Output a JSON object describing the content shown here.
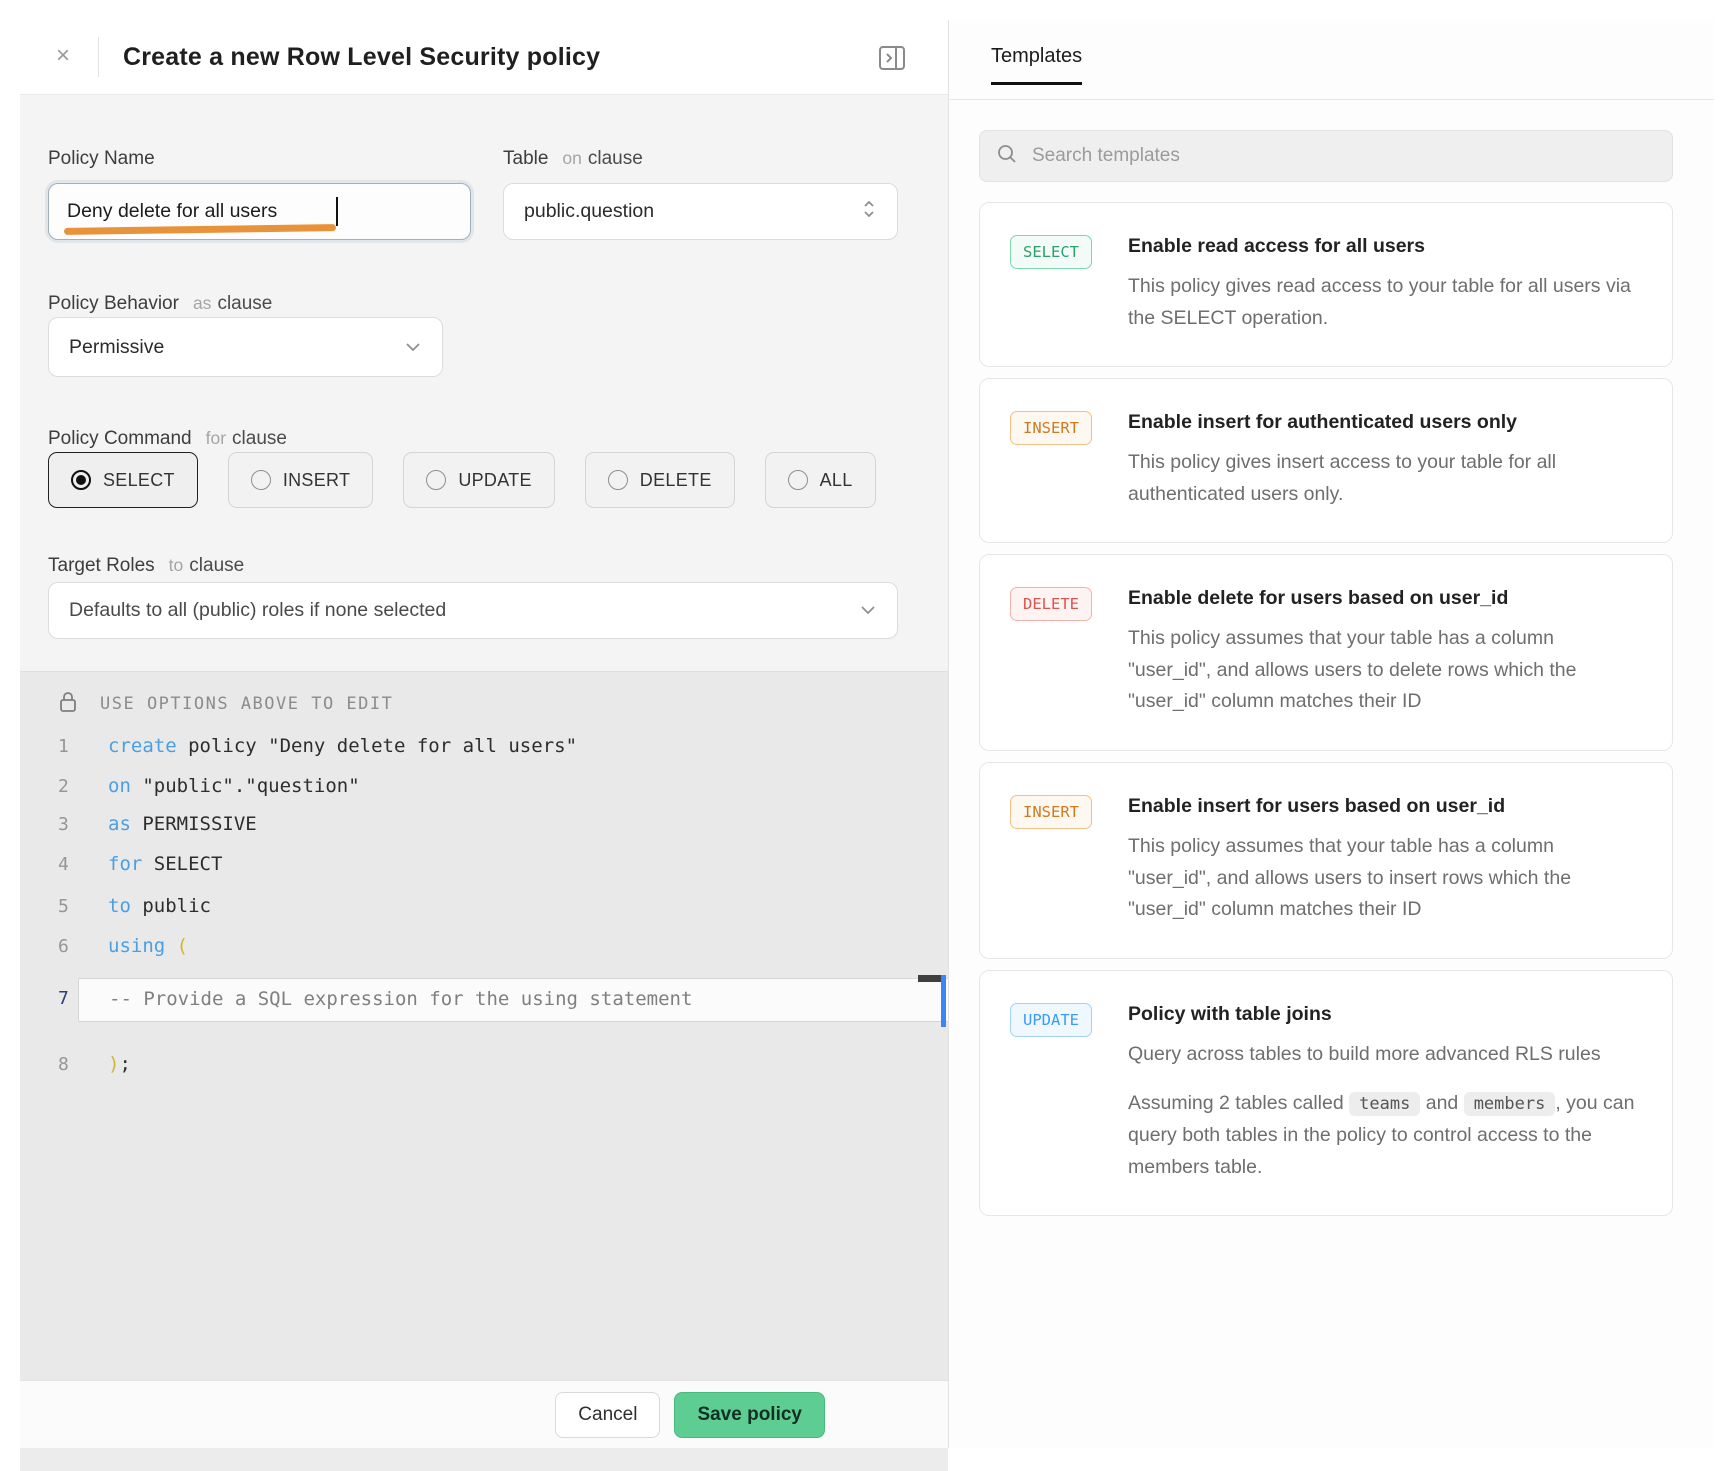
{
  "dialog": {
    "title": "Create a new Row Level Security policy",
    "close_icon": "×",
    "policy_name": {
      "label": "Policy Name",
      "value": "Deny delete for all users"
    },
    "table": {
      "label": "Table",
      "kw": "on",
      "clause": "clause",
      "value": "public.question"
    },
    "behavior": {
      "label": "Policy Behavior",
      "kw": "as",
      "clause": "clause",
      "value": "Permissive"
    },
    "command": {
      "label": "Policy Command",
      "kw": "for",
      "clause": "clause",
      "selected": "SELECT",
      "options": [
        {
          "label": "SELECT"
        },
        {
          "label": "INSERT"
        },
        {
          "label": "UPDATE"
        },
        {
          "label": "DELETE"
        },
        {
          "label": "ALL"
        }
      ]
    },
    "roles": {
      "label": "Target Roles",
      "kw": "to",
      "clause": "clause",
      "value": "Defaults to all (public) roles if none selected"
    },
    "editor": {
      "notice": "USE OPTIONS ABOVE TO EDIT",
      "lines": [
        {
          "num": "1",
          "kw": "create",
          "rest": " policy \"Deny delete for all users\""
        },
        {
          "num": "2",
          "kw": "on",
          "rest": " \"public\".\"question\""
        },
        {
          "num": "3",
          "kw": "as",
          "rest": " PERMISSIVE"
        },
        {
          "num": "4",
          "kw": "for",
          "rest": " SELECT"
        },
        {
          "num": "5",
          "kw": "to",
          "rest": " public"
        },
        {
          "num": "6",
          "kw": "using",
          "paren": " ("
        },
        {
          "num": "7",
          "comment": "-- Provide a SQL expression for the using statement"
        },
        {
          "num": "8",
          "paren": ")",
          "rest": ";"
        }
      ]
    },
    "footer": {
      "cancel": "Cancel",
      "save": "Save policy"
    }
  },
  "templates": {
    "tab": "Templates",
    "search_placeholder": "Search templates",
    "cards": [
      {
        "badge": "SELECT",
        "title": "Enable read access for all users",
        "desc": "This policy gives read access to your table for all users via the SELECT operation."
      },
      {
        "badge": "INSERT",
        "title": "Enable insert for authenticated users only",
        "desc": "This policy gives insert access to your table for all authenticated users only."
      },
      {
        "badge": "DELETE",
        "title": "Enable delete for users based on user_id",
        "desc": "This policy assumes that your table has a column \"user_id\", and allows users to delete rows which the \"user_id\" column matches their ID"
      },
      {
        "badge": "INSERT",
        "title": "Enable insert for users based on user_id",
        "desc": "This policy assumes that your table has a column \"user_id\", and allows users to insert rows which the \"user_id\" column matches their ID"
      },
      {
        "badge": "UPDATE",
        "title": "Policy with table joins",
        "desc": "Query across tables to build more advanced RLS rules",
        "desc2_pre": "Assuming 2 tables called ",
        "chip1": "teams",
        "desc2_mid": " and ",
        "chip2": "members",
        "desc2_post": ", you can query both tables in the policy to control access to the members table."
      }
    ]
  },
  "colors": {
    "accent_green": "#3ecf8e",
    "save_button_green": "#5ecd92",
    "keyword_blue": "#4a9fe3",
    "paren_yellow": "#d4b33a",
    "badge_select_green": "#2e9e6b",
    "badge_insert_orange": "#cf7a23",
    "badge_delete_red": "#d9544f",
    "badge_update_blue": "#3a9bf5",
    "annotation_orange": "#e78d2e"
  }
}
